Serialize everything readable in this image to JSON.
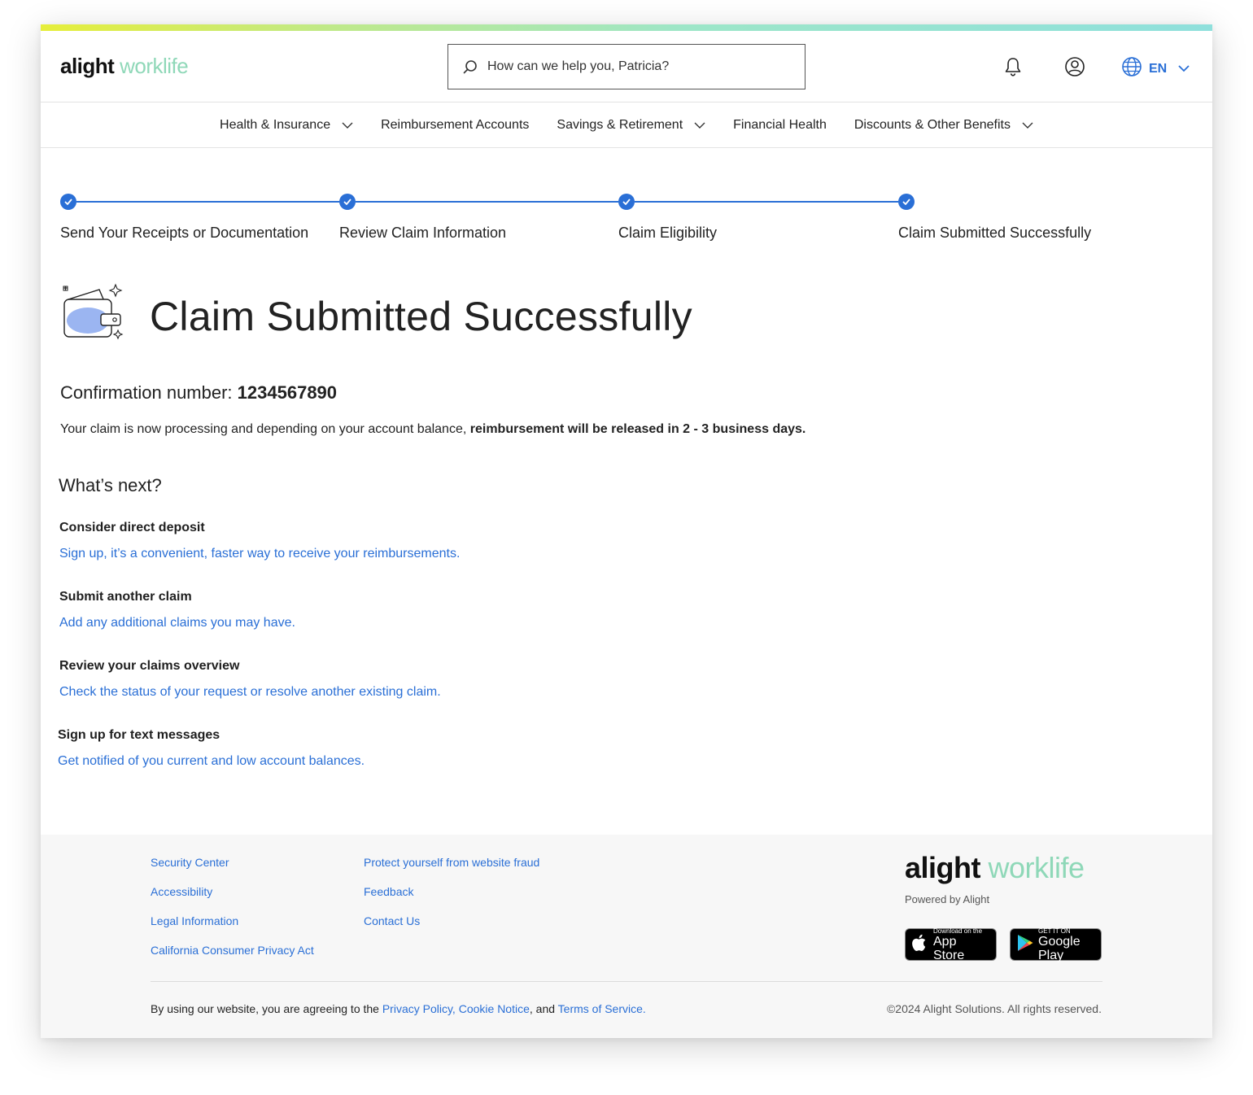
{
  "header": {
    "logo_brand": "alight",
    "logo_product": "worklife",
    "search_placeholder": "How can we help you, Patricia?",
    "language": "EN"
  },
  "nav": {
    "items": [
      {
        "label": "Health & Insurance",
        "dropdown": true
      },
      {
        "label": "Reimbursement Accounts",
        "dropdown": false
      },
      {
        "label": "Savings & Retirement",
        "dropdown": true
      },
      {
        "label": "Financial Health",
        "dropdown": false
      },
      {
        "label": "Discounts & Other Benefits",
        "dropdown": true
      }
    ]
  },
  "stepper": {
    "steps": [
      {
        "label": "Send Your Receipts or Documentation",
        "status": "complete"
      },
      {
        "label": "Review Claim Information",
        "status": "complete"
      },
      {
        "label": "Claim Eligibility",
        "status": "complete"
      },
      {
        "label": "Claim Submitted Successfully",
        "status": "complete"
      }
    ]
  },
  "main": {
    "title": "Claim Submitted Successfully",
    "confirmation_label": "Confirmation number:",
    "confirmation_number": "1234567890",
    "processing_text": "Your claim is now processing and depending on your account balance,",
    "processing_bold": "reimbursement will be released in 2 - 3 business days.",
    "whats_next_title": "What’s next?",
    "next_items": [
      {
        "title": "Consider direct deposit",
        "link": "Sign up, it’s a convenient, faster way to receive your reimbursements."
      },
      {
        "title": "Submit another claim",
        "link": "Add any additional claims you may have."
      },
      {
        "title": "Review your claims overview",
        "link": "Check the status of your request or resolve another existing claim."
      },
      {
        "title": "Sign up for text messages",
        "link": "Get notified of you current and low account balances."
      }
    ]
  },
  "footer": {
    "col1": [
      "Security Center",
      "Accessibility",
      "Legal Information",
      "California Consumer Privacy Act"
    ],
    "col2": [
      "Protect yourself from website fraud",
      "Feedback",
      "Contact Us"
    ],
    "logo_brand": "alight",
    "logo_product": "worklife",
    "powered_by": "Powered by Alight",
    "app_store_small": "Download on the",
    "app_store_big": "App Store",
    "google_play_small": "GET IT ON",
    "google_play_big": "Google Play",
    "legal_prefix": "By using our website, you are agreeing to the",
    "privacy_policy": "Privacy Policy,",
    "cookie_notice": "Cookie Notice",
    "legal_and": ", and",
    "terms": "Terms of Service.",
    "copyright": "©2024 Alight Solutions. All rights reserved."
  },
  "colors": {
    "accent": "#2a6fd6",
    "brand_green": "#8fd8b8"
  }
}
